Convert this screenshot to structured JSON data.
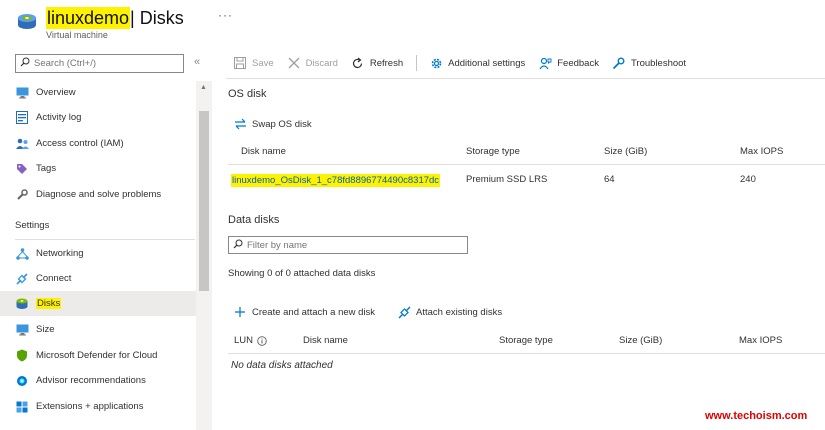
{
  "header": {
    "resource_name": "linuxdemo",
    "separator_title": "| Disks",
    "subtitle": "Virtual machine",
    "more": "···"
  },
  "sidebar": {
    "search_placeholder": "Search (Ctrl+/)",
    "collapse": "«",
    "items_top": [
      {
        "label": "Overview",
        "icon": "monitor-icon"
      },
      {
        "label": "Activity log",
        "icon": "activity-log-icon"
      },
      {
        "label": "Access control (IAM)",
        "icon": "people-icon"
      },
      {
        "label": "Tags",
        "icon": "tag-icon"
      },
      {
        "label": "Diagnose and solve problems",
        "icon": "wrench-icon"
      }
    ],
    "settings_heading": "Settings",
    "items_settings": [
      {
        "label": "Networking",
        "icon": "network-icon"
      },
      {
        "label": "Connect",
        "icon": "connect-icon"
      },
      {
        "label": "Disks",
        "icon": "disk-icon",
        "active": true
      },
      {
        "label": "Size",
        "icon": "monitor-icon"
      },
      {
        "label": "Microsoft Defender for Cloud",
        "icon": "shield-icon"
      },
      {
        "label": "Advisor recommendations",
        "icon": "advisor-icon"
      },
      {
        "label": "Extensions + applications",
        "icon": "extensions-icon"
      }
    ]
  },
  "toolbar": {
    "save": "Save",
    "discard": "Discard",
    "refresh": "Refresh",
    "additional_settings": "Additional settings",
    "feedback": "Feedback",
    "troubleshoot": "Troubleshoot"
  },
  "os_disk": {
    "title": "OS disk",
    "swap": "Swap OS disk",
    "columns": [
      "Disk name",
      "Storage type",
      "Size (GiB)",
      "Max IOPS"
    ],
    "row": {
      "name": "linuxdemo_OsDisk_1_c78fd8896774490c8317dc",
      "storage_type": "Premium SSD LRS",
      "size": "64",
      "max_iops": "240"
    }
  },
  "data_disks": {
    "title": "Data disks",
    "filter_placeholder": "Filter by name",
    "showing": "Showing 0 of 0 attached data disks",
    "create_attach": "Create and attach a new disk",
    "attach_existing": "Attach existing disks",
    "columns": [
      "LUN",
      "Disk name",
      "Storage type",
      "Size (GiB)",
      "Max IOPS"
    ],
    "empty": "No data disks attached"
  },
  "watermark": "www.techoism.com",
  "colors": {
    "highlight": "#fff200",
    "link": "#0062ad",
    "accent": "#0078d4",
    "watermark": "#e00000"
  }
}
